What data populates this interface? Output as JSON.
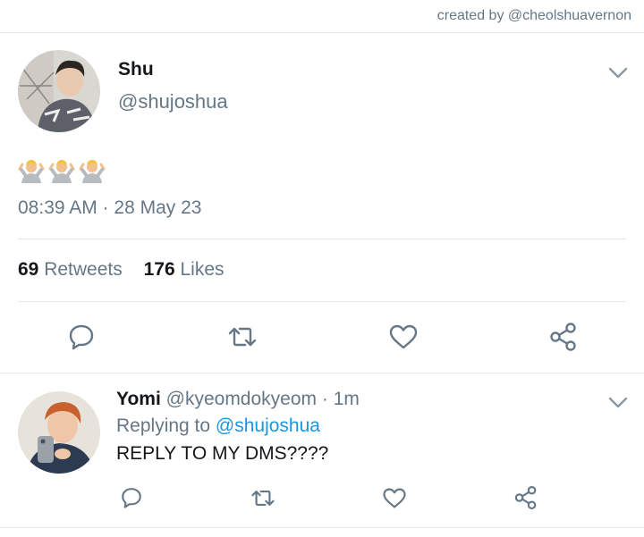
{
  "credit": "created by @cheolshuavernon",
  "tweet": {
    "name": "Shu",
    "handle": "@shujoshua",
    "emoji": "🤷‍♂️🤷‍♂️🤷‍♂️",
    "timestamp": "08:39 AM · 28 May 23",
    "retweets_count": "69",
    "retweets_label": "Retweets",
    "likes_count": "176",
    "likes_label": "Likes"
  },
  "reply": {
    "name": "Yomi",
    "handle": "@kyeomdokyeom",
    "sep": "·",
    "time": "1m",
    "replying_prefix": "Replying to",
    "replying_to": "@shujoshua",
    "text": "REPLY TO MY DMS????"
  },
  "colors": {
    "text": "#14171a",
    "muted": "#657786",
    "link": "#1b95e0",
    "divider": "#e1e8ed"
  }
}
